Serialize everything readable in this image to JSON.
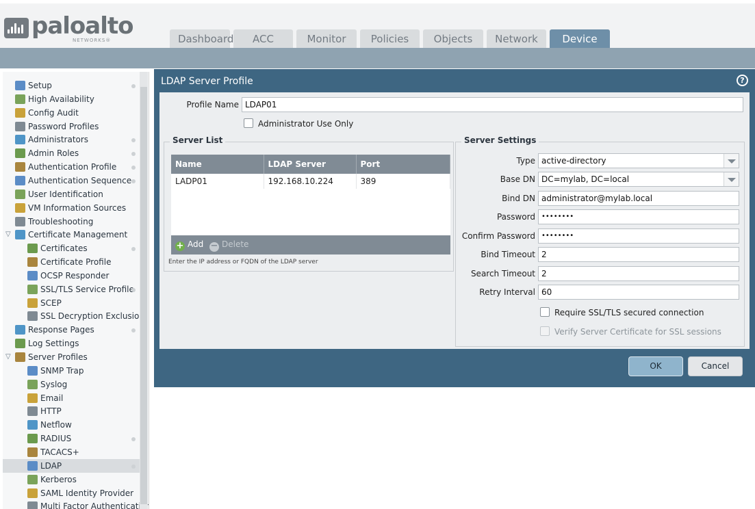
{
  "brand": {
    "name": "paloalto",
    "sub": "NETWORKS®"
  },
  "tabs": [
    {
      "label": "Dashboard",
      "active": false
    },
    {
      "label": "ACC",
      "active": false
    },
    {
      "label": "Monitor",
      "active": false
    },
    {
      "label": "Policies",
      "active": false
    },
    {
      "label": "Objects",
      "active": false
    },
    {
      "label": "Network",
      "active": false
    },
    {
      "label": "Device",
      "active": true
    }
  ],
  "sidebar": {
    "items": [
      {
        "label": "Setup",
        "icon": "setup-icon",
        "dot": true
      },
      {
        "label": "High Availability",
        "icon": "high-availability-icon"
      },
      {
        "label": "Config Audit",
        "icon": "config-audit-icon"
      },
      {
        "label": "Password Profiles",
        "icon": "password-profiles-icon"
      },
      {
        "label": "Administrators",
        "icon": "administrators-icon",
        "dot": true
      },
      {
        "label": "Admin Roles",
        "icon": "admin-roles-icon",
        "dot": true
      },
      {
        "label": "Authentication Profile",
        "icon": "authentication-profile-icon",
        "dot": true
      },
      {
        "label": "Authentication Sequence",
        "icon": "authentication-sequence-icon",
        "dot": true
      },
      {
        "label": "User Identification",
        "icon": "user-identification-icon"
      },
      {
        "label": "VM Information Sources",
        "icon": "vm-information-sources-icon"
      },
      {
        "label": "Troubleshooting",
        "icon": "troubleshooting-icon"
      },
      {
        "label": "Certificate Management",
        "icon": "certificate-management-icon",
        "expanded": true
      },
      {
        "label": "Certificates",
        "icon": "certificates-icon",
        "child": true,
        "dot": true
      },
      {
        "label": "Certificate Profile",
        "icon": "certificate-profile-icon",
        "child": true
      },
      {
        "label": "OCSP Responder",
        "icon": "ocsp-responder-icon",
        "child": true
      },
      {
        "label": "SSL/TLS Service Profile",
        "icon": "ssl-tls-service-profile-icon",
        "child": true,
        "dot": true
      },
      {
        "label": "SCEP",
        "icon": "scep-icon",
        "child": true
      },
      {
        "label": "SSL Decryption Exclusion",
        "icon": "ssl-decryption-exclusion-icon",
        "child": true
      },
      {
        "label": "Response Pages",
        "icon": "response-pages-icon",
        "dot": true
      },
      {
        "label": "Log Settings",
        "icon": "log-settings-icon"
      },
      {
        "label": "Server Profiles",
        "icon": "server-profiles-icon",
        "expanded": true
      },
      {
        "label": "SNMP Trap",
        "icon": "snmp-trap-icon",
        "child": true
      },
      {
        "label": "Syslog",
        "icon": "syslog-icon",
        "child": true
      },
      {
        "label": "Email",
        "icon": "email-icon",
        "child": true
      },
      {
        "label": "HTTP",
        "icon": "http-icon",
        "child": true
      },
      {
        "label": "Netflow",
        "icon": "netflow-icon",
        "child": true
      },
      {
        "label": "RADIUS",
        "icon": "radius-icon",
        "child": true,
        "dot": true
      },
      {
        "label": "TACACS+",
        "icon": "tacacs-icon",
        "child": true
      },
      {
        "label": "LDAP",
        "icon": "ldap-icon",
        "child": true,
        "selected": true,
        "dot": true
      },
      {
        "label": "Kerberos",
        "icon": "kerberos-icon",
        "child": true
      },
      {
        "label": "SAML Identity Provider",
        "icon": "saml-identity-provider-icon",
        "child": true
      },
      {
        "label": "Multi Factor Authentication",
        "icon": "multi-factor-authentication-icon",
        "child": true
      }
    ]
  },
  "dialog": {
    "title": "LDAP Server Profile",
    "profile_name_label": "Profile Name",
    "profile_name_value": "LDAP01",
    "admin_use_only_label": "Administrator Use Only",
    "server_list": {
      "title": "Server List",
      "columns": [
        "Name",
        "LDAP Server",
        "Port"
      ],
      "rows": [
        [
          "LADP01",
          "192.168.10.224",
          "389"
        ]
      ],
      "add_label": "Add",
      "delete_label": "Delete",
      "hint": "Enter the IP address or FQDN of the LDAP server"
    },
    "server_settings": {
      "title": "Server Settings",
      "type_label": "Type",
      "type_value": "active-directory",
      "base_dn_label": "Base DN",
      "base_dn_value": "DC=mylab, DC=local",
      "bind_dn_label": "Bind DN",
      "bind_dn_value": "administrator@mylab.local",
      "password_label": "Password",
      "password_value": "••••••••",
      "confirm_password_label": "Confirm Password",
      "confirm_password_value": "••••••••",
      "bind_timeout_label": "Bind Timeout",
      "bind_timeout_value": "2",
      "search_timeout_label": "Search Timeout",
      "search_timeout_value": "2",
      "retry_interval_label": "Retry Interval",
      "retry_interval_value": "60",
      "require_ssl_label": "Require SSL/TLS secured connection",
      "verify_cert_label": "Verify Server Certificate for SSL sessions"
    },
    "ok_label": "OK",
    "cancel_label": "Cancel"
  },
  "colors": {
    "accent": "#6e8fa8",
    "dialog": "#3e6682",
    "header_band": "#8fa3b1"
  }
}
